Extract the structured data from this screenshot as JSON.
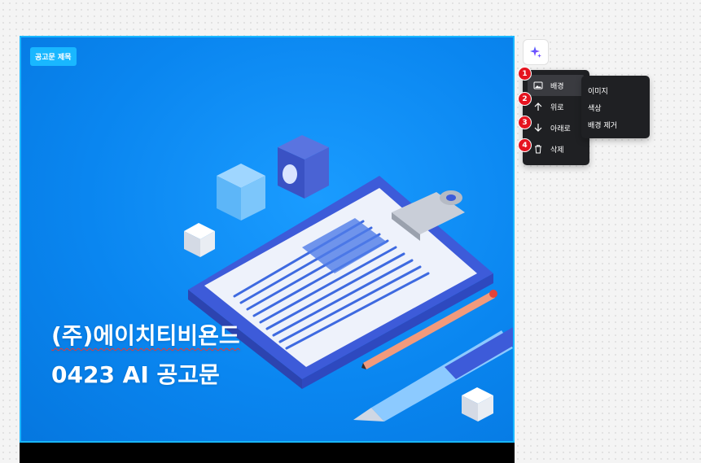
{
  "poster": {
    "tag_label": "공고문 제목",
    "headline_line1": "(주)에이치티비욘드",
    "headline_line2": "0423 AI 공고문"
  },
  "ai_button": {
    "icon": "sparkle-icon"
  },
  "context_menu": {
    "items": [
      {
        "badge": "1",
        "label": "배경",
        "icon": "image-icon"
      },
      {
        "badge": "2",
        "label": "위로",
        "icon": "arrow-up-icon"
      },
      {
        "badge": "3",
        "label": "아래로",
        "icon": "arrow-down-icon"
      },
      {
        "badge": "4",
        "label": "삭제",
        "icon": "trash-icon"
      }
    ]
  },
  "background_submenu": {
    "items": [
      "이미지",
      "색상",
      "배경 제거"
    ]
  },
  "colors": {
    "poster_bg": "#0a86f0",
    "selection_border": "#19b7ff",
    "menu_bg": "#1f2023",
    "badge": "#e5131f"
  }
}
